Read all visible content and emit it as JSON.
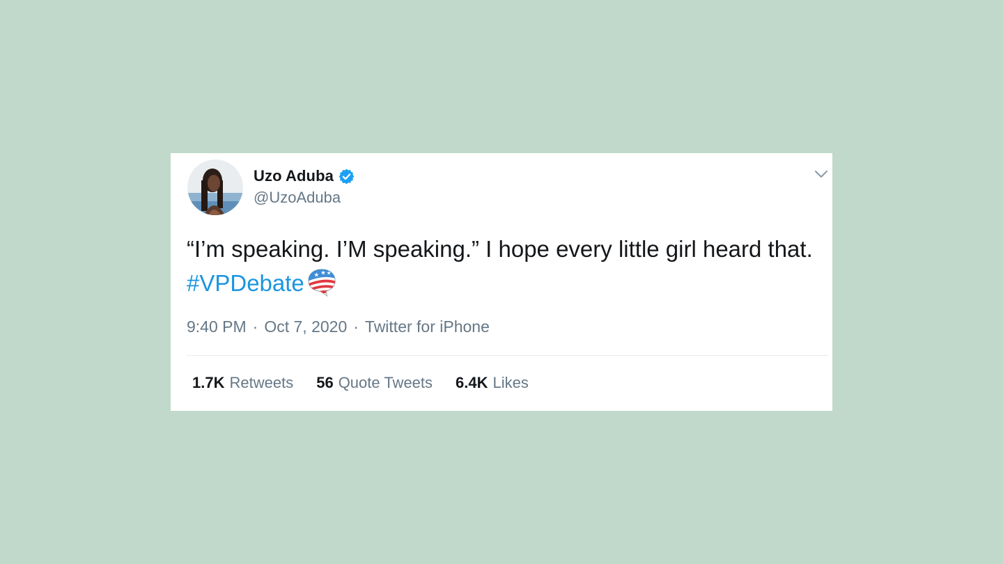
{
  "colors": {
    "background": "#c1d9cb",
    "card": "#ffffff",
    "text_primary": "#14171a",
    "text_secondary": "#657786",
    "link": "#1b95e0",
    "verified_badge": "#1da1f2"
  },
  "user": {
    "display_name": "Uzo Aduba",
    "handle": "@UzoAduba",
    "verified": true,
    "avatar_icon": "profile-photo",
    "verified_icon": "verified-badge-icon"
  },
  "tweet": {
    "text": "“I’m speaking. I’M speaking.” I hope every little girl heard that. ",
    "hashtag": "#VPDebate",
    "hashtag_emoji_icon": "vpdebate-flag-speech-bubble-icon",
    "time": "9:40 PM",
    "date": "Oct 7, 2020",
    "separator": "·",
    "source": "Twitter for iPhone"
  },
  "menu": {
    "caret_icon": "chevron-down-icon"
  },
  "stats": [
    {
      "count": "1.7K",
      "label": "Retweets"
    },
    {
      "count": "56",
      "label": "Quote Tweets"
    },
    {
      "count": "6.4K",
      "label": "Likes"
    }
  ]
}
